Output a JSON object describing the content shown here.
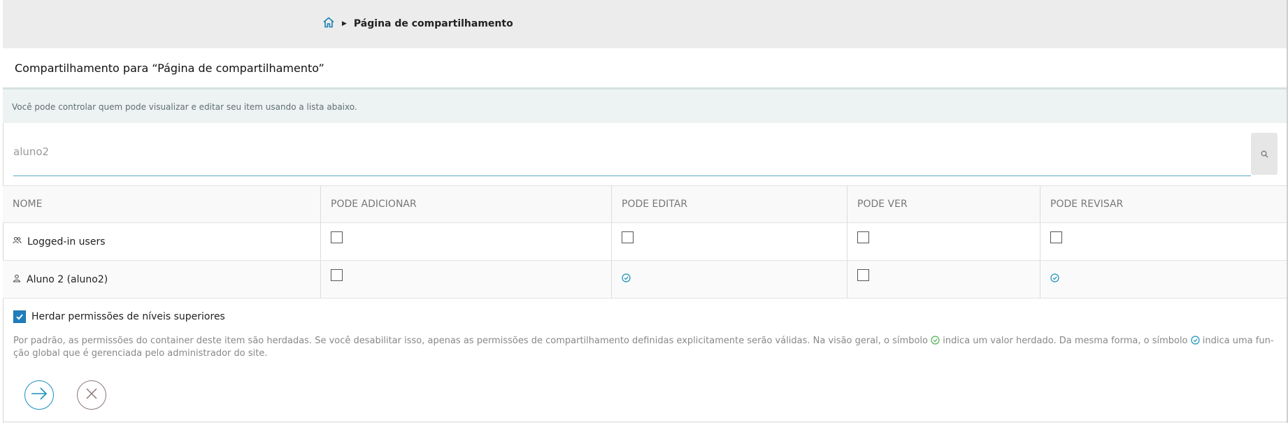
{
  "breadcrumb": {
    "home_icon": "home-icon",
    "current": "Página de compartilhamento"
  },
  "header": {
    "title": "Compartilhamento para “Página de compartilhamento”"
  },
  "help": {
    "text": "Você pode controlar quem pode visualizar e editar seu item usando a lista abaixo."
  },
  "search": {
    "value": "aluno2",
    "icon": "search-icon"
  },
  "table": {
    "columns": [
      "NOME",
      "PODE ADICIONAR",
      "PODE EDITAR",
      "PODE VER",
      "PODE REVISAR"
    ],
    "rows": [
      {
        "name": "Logged-in users",
        "icon": "group-icon",
        "add": "unchecked",
        "edit": "unchecked",
        "view": "unchecked",
        "review": "unchecked"
      },
      {
        "name": "Aluno 2 (aluno2)",
        "icon": "user-icon",
        "add": "unchecked",
        "edit": "global",
        "view": "unchecked",
        "review": "global"
      }
    ]
  },
  "inherit": {
    "label": "Herdar permissões de níveis superiores",
    "checked": true
  },
  "note": {
    "part1": "Por padrão, as permissões do container deste item são herdadas. Se você desabilitar isso, apenas as permissões de compartilhamento definidas explicitamente serão válidas. Na visão geral, o símbolo",
    "part2": "indica um valor herdado. Da mesma forma, o símbolo",
    "part3": "indica uma fun-ção global que é gerenciada pelo administrador do site."
  },
  "buttons": {
    "save_icon": "arrow-right-icon",
    "cancel_icon": "close-icon"
  },
  "colors": {
    "accent": "#1b8fbc",
    "inherited": "#4caf50",
    "checkbox_checked": "#1e7fbf"
  }
}
